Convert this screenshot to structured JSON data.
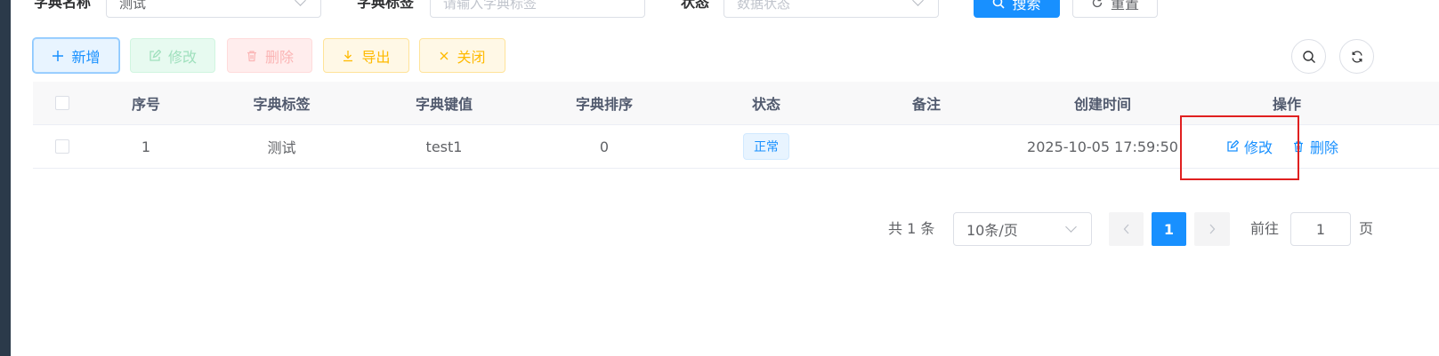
{
  "form": {
    "dict_name_label": "字典名称",
    "dict_name_value": "测试",
    "dict_label_label": "字典标签",
    "dict_label_placeholder": "请输入字典标签",
    "status_label": "状态",
    "status_placeholder": "数据状态",
    "search_button": "搜索",
    "reset_button": "重置"
  },
  "toolbar": {
    "add": "新增",
    "edit": "修改",
    "delete": "删除",
    "export": "导出",
    "close": "关闭"
  },
  "table": {
    "headers": [
      "序号",
      "字典标签",
      "字典键值",
      "字典排序",
      "状态",
      "备注",
      "创建时间",
      "操作"
    ],
    "rows": [
      {
        "index": "1",
        "label": "测试",
        "value": "test1",
        "sort": "0",
        "status": "正常",
        "remark": "",
        "created": "2025-10-05 17:59:50",
        "action_edit": "修改",
        "action_delete": "删除"
      }
    ]
  },
  "pagination": {
    "total": "共 1 条",
    "page_size": "10条/页",
    "current_page": "1",
    "goto_label": "前往",
    "goto_value": "1",
    "page_suffix": "页"
  },
  "colors": {
    "primary": "#1890ff",
    "highlight_box": "#e02020"
  }
}
